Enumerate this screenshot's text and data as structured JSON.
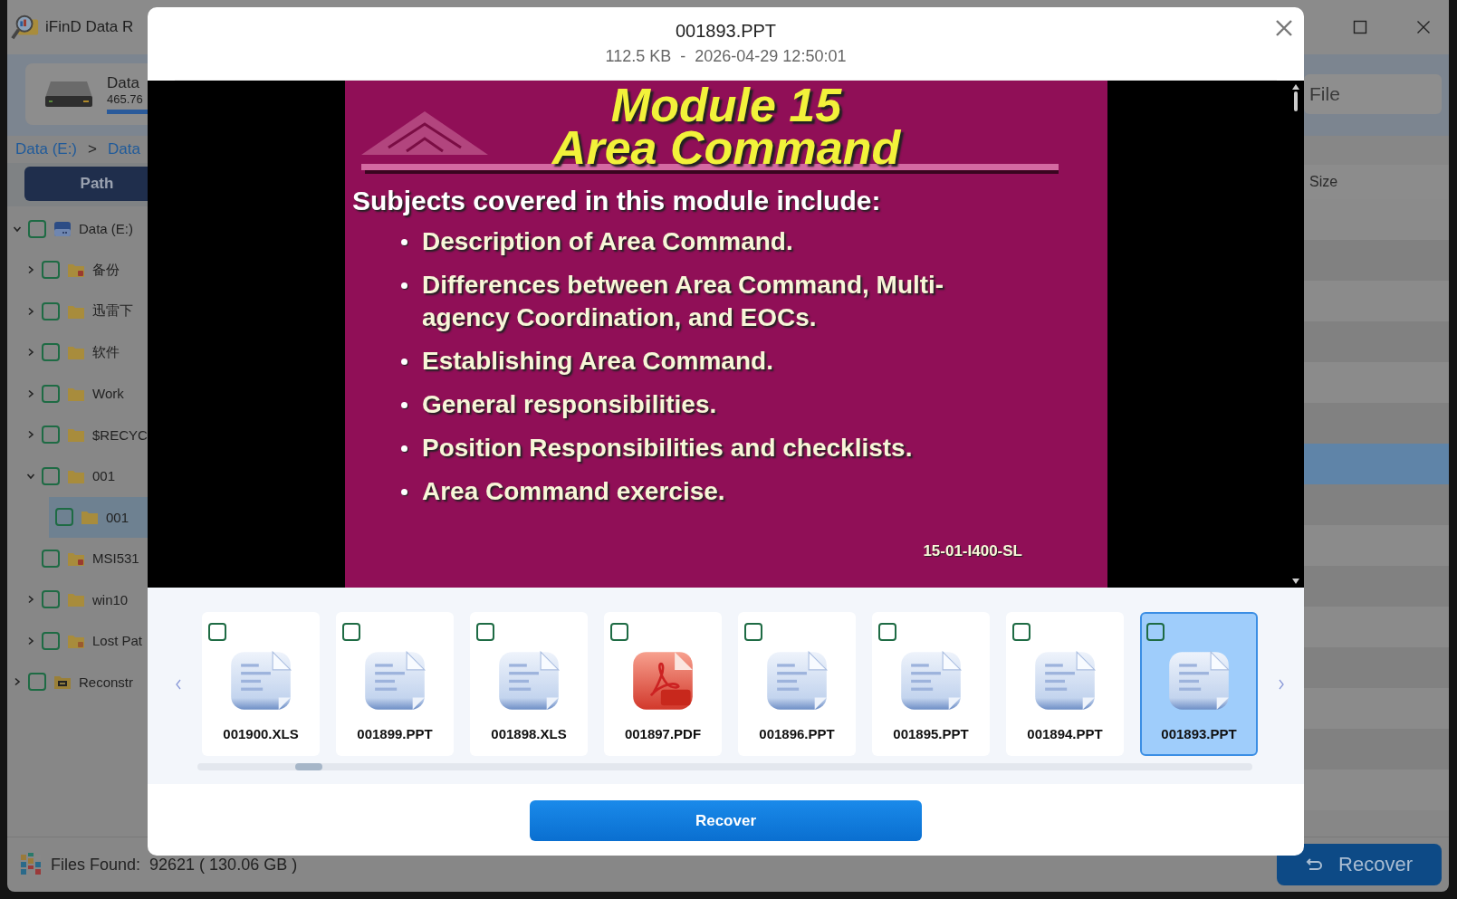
{
  "app": {
    "title": "iFinD Data R"
  },
  "drive_card": {
    "name": "Data",
    "size": "465.76"
  },
  "breadcrumb": {
    "items": [
      "Data (E:)",
      "Data"
    ],
    "separator": ">"
  },
  "tabs": [
    {
      "label": "Path",
      "selected": true
    }
  ],
  "tree": [
    {
      "label": "Data (E:)",
      "kind": "drive",
      "expanded": true,
      "checked": false,
      "selected": false,
      "children": [
        {
          "label": "备份",
          "kind": "damaged-folder",
          "expanded": false,
          "checked": false,
          "selected": false
        },
        {
          "label": "迅雷下",
          "kind": "folder",
          "expanded": false,
          "checked": false,
          "selected": false
        },
        {
          "label": "软件",
          "kind": "folder",
          "expanded": false,
          "checked": false,
          "selected": false
        },
        {
          "label": "Work",
          "kind": "folder",
          "expanded": false,
          "checked": false,
          "selected": false
        },
        {
          "label": "$RECYC",
          "kind": "folder",
          "expanded": false,
          "checked": false,
          "selected": false
        },
        {
          "label": "001",
          "kind": "folder",
          "expanded": true,
          "checked": false,
          "selected": false,
          "children": [
            {
              "label": "001",
              "kind": "folder",
              "checked": false,
              "selected": true
            }
          ]
        },
        {
          "label": "MSI531",
          "kind": "damaged-folder",
          "checked": false,
          "selected": false
        },
        {
          "label": "win10",
          "kind": "folder",
          "expanded": false,
          "checked": false,
          "selected": false
        },
        {
          "label": "Lost Pat",
          "kind": "lost-folder",
          "expanded": false,
          "checked": false,
          "selected": false
        }
      ]
    },
    {
      "label": "Reconstr",
      "kind": "reconstructed",
      "expanded": false,
      "checked": false,
      "selected": false
    }
  ],
  "search": {
    "placeholder": "File"
  },
  "file_table": {
    "columns": [
      "Size"
    ],
    "rows": [
      {
        "selected": false
      },
      {
        "selected": false
      },
      {
        "selected": false
      },
      {
        "selected": false
      },
      {
        "selected": false
      },
      {
        "selected": false
      },
      {
        "selected": true
      },
      {
        "selected": false
      },
      {
        "selected": false
      },
      {
        "selected": false
      },
      {
        "selected": false
      },
      {
        "selected": false
      },
      {
        "selected": false
      },
      {
        "selected": false
      },
      {
        "selected": false
      }
    ]
  },
  "status_bar": {
    "label": "Files Found:",
    "value": "92621 ( 130.06 GB )"
  },
  "recover_button": "Recover",
  "preview": {
    "title": "001893.PPT",
    "info": "112.5 KB  -  2026-04-29 12:50:01",
    "slide": {
      "title_lines": [
        "Module 15",
        "Area Command"
      ],
      "heading": "Subjects covered in this module include:",
      "bullets": [
        "Description of Area Command.",
        "Differences between Area Command, Multi-agency Coordination, and EOCs.",
        "Establishing Area Command.",
        "General responsibilities.",
        "Position Responsibilities and checklists.",
        "Area Command exercise."
      ],
      "footer": "15-01-I400-SL"
    },
    "thumbnails": [
      {
        "name": "001900.XLS",
        "kind": "doc",
        "checked": false,
        "selected": false
      },
      {
        "name": "001899.PPT",
        "kind": "doc",
        "checked": false,
        "selected": false
      },
      {
        "name": "001898.XLS",
        "kind": "doc",
        "checked": false,
        "selected": false
      },
      {
        "name": "001897.PDF",
        "kind": "pdf",
        "checked": false,
        "selected": false
      },
      {
        "name": "001896.PPT",
        "kind": "doc",
        "checked": false,
        "selected": false
      },
      {
        "name": "001895.PPT",
        "kind": "doc",
        "checked": false,
        "selected": false
      },
      {
        "name": "001894.PPT",
        "kind": "doc",
        "checked": false,
        "selected": false
      },
      {
        "name": "001893.PPT",
        "kind": "doc",
        "checked": false,
        "selected": true
      }
    ],
    "button": "Recover"
  }
}
